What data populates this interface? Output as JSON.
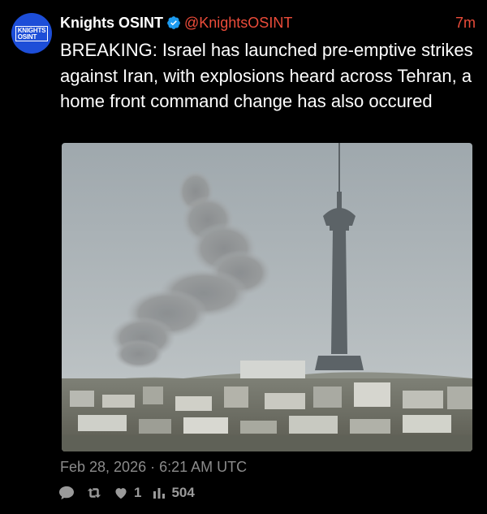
{
  "author": {
    "name": "Knights OSINT",
    "handle": "@KnightsOSINT",
    "avatar_text_line1": "KNIGHTS",
    "avatar_text_line2": "OSINT",
    "verified_icon": "verified-badge-icon"
  },
  "post": {
    "relative_time": "7m",
    "text": "BREAKING: Israel has launched pre-emptive strikes against Iran, with explosions heard across Tehran, a  home front command change has also occured",
    "timestamp": "Feb 28, 2026 · 6:21 AM UTC"
  },
  "stats": {
    "reply_icon": "speech-bubble-icon",
    "repost_icon": "repost-arrows-icon",
    "like_icon": "heart-icon",
    "likes": "1",
    "views_icon": "bar-chart-icon",
    "views": "504"
  },
  "colors": {
    "background": "#000000",
    "accent": "#ec4c3a",
    "verified": "#1d9bf0",
    "muted": "#8b8b8b",
    "avatar_bg": "#1d4ed8"
  }
}
